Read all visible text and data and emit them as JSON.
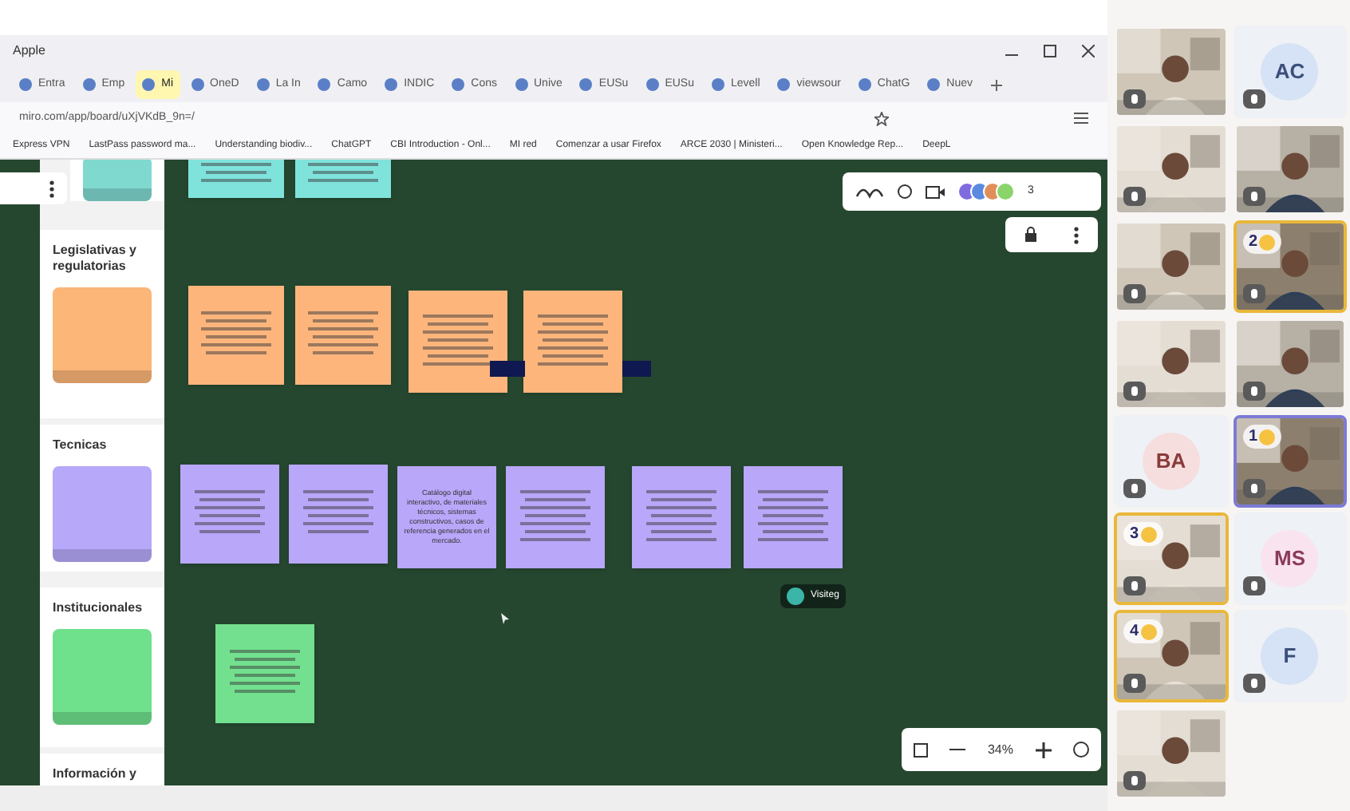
{
  "window": {
    "title": "Apple"
  },
  "tabs": [
    {
      "label": "Entra",
      "selected": false
    },
    {
      "label": "Emp",
      "selected": false
    },
    {
      "label": "Mi",
      "selected": true
    },
    {
      "label": "OneD",
      "selected": false
    },
    {
      "label": "La In",
      "selected": false
    },
    {
      "label": "Camo",
      "selected": false
    },
    {
      "label": "INDIC",
      "selected": false
    },
    {
      "label": "Cons",
      "selected": false
    },
    {
      "label": "Unive",
      "selected": false
    },
    {
      "label": "EUSu",
      "selected": false
    },
    {
      "label": "EUSu",
      "selected": false
    },
    {
      "label": "Levell",
      "selected": false
    },
    {
      "label": "viewsour",
      "selected": false
    },
    {
      "label": "ChatG",
      "selected": false
    },
    {
      "label": "Nuev",
      "selected": false
    }
  ],
  "address_bar": {
    "url": "miro.com/app/board/uXjVKdB_9n=/"
  },
  "bookmarks": [
    "Express VPN",
    "LastPass password ma...",
    "Understanding biodiv...",
    "ChatGPT",
    "CBI Introduction - Onl...",
    "MI red",
    "Comenzar a usar Firefox",
    "ARCE 2030 | Ministeri...",
    "Open Knowledge Rep...",
    "DeepL"
  ],
  "board": {
    "library": [
      {
        "color": "#7fd9cf"
      },
      {
        "title": "Legislativas y regulatorias",
        "color": "#fbb678"
      },
      {
        "title": "Tecnicas",
        "color": "#b7a8fa"
      },
      {
        "title": "Institucionales",
        "color": "#6fe08c"
      },
      {
        "title": "Información y"
      }
    ],
    "notes": [
      {
        "color": "#7fe3dc"
      },
      {
        "color": "#7fe3dc"
      },
      {
        "color": "#fdb57c"
      },
      {
        "color": "#fdb57c"
      },
      {
        "color": "#fdb57c"
      },
      {
        "color": "#fdb57c"
      },
      {
        "color": "#b9a7fa"
      },
      {
        "color": "#b9a7fa"
      },
      {
        "color": "#b9a7fa",
        "text": "Catálogo digital interactivo, de materiales técnicos, sistemas constructivos, casos de referencia generados en el mercado."
      },
      {
        "color": "#b9a7fa"
      },
      {
        "color": "#b9a7fa"
      },
      {
        "color": "#b9a7fa"
      },
      {
        "color": "#72e08e"
      }
    ],
    "collaborators": "3",
    "cursor_label": "Visiteg",
    "zoom": "34%"
  },
  "participants": [
    {
      "kind": "video"
    },
    {
      "kind": "initials",
      "initials": "AC"
    },
    {
      "kind": "video"
    },
    {
      "kind": "video"
    },
    {
      "kind": "video"
    },
    {
      "kind": "video",
      "hand": "2",
      "color": "#e9b73a"
    },
    {
      "kind": "video"
    },
    {
      "kind": "video"
    },
    {
      "kind": "initials",
      "initials": "BA"
    },
    {
      "kind": "video",
      "hand": "1",
      "color": "#7c7ad6"
    },
    {
      "kind": "video",
      "hand": "3",
      "color": "#e9b73a"
    },
    {
      "kind": "initials",
      "initials": "MS"
    },
    {
      "kind": "video",
      "hand": "4",
      "color": "#e9b73a"
    },
    {
      "kind": "initials",
      "initials": "F"
    },
    {
      "kind": "video"
    }
  ]
}
